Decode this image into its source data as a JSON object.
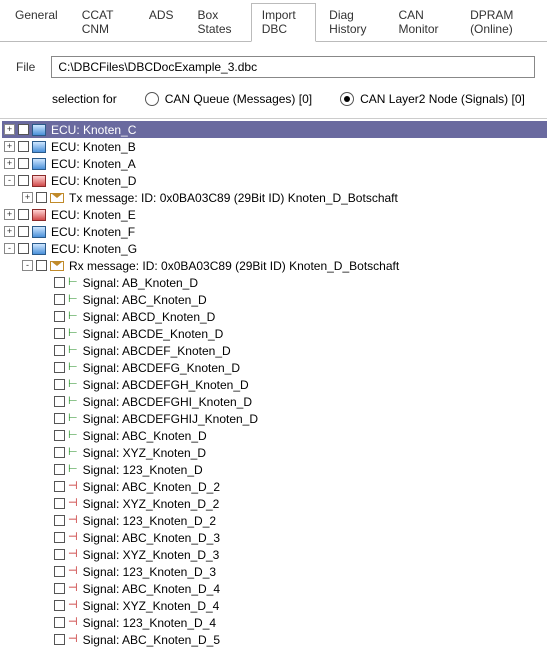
{
  "tabs": {
    "items": [
      "General",
      "CCAT CNM",
      "ADS",
      "Box States",
      "Import DBC",
      "Diag History",
      "CAN Monitor",
      "DPRAM (Online)"
    ],
    "activeIndex": 4
  },
  "fileRow": {
    "label": "File",
    "path": "C:\\DBCFiles\\DBCDocExample_3.dbc"
  },
  "selection": {
    "label": "selection for",
    "opt1": "CAN Queue (Messages) [0]",
    "opt2": "CAN Layer2 Node (Signals) [0]",
    "checked": 1
  },
  "tree": [
    {
      "indent": 0,
      "exp": "+",
      "chk": true,
      "icon": "ecu",
      "text": "ECU:   Knoten_C",
      "sel": true
    },
    {
      "indent": 0,
      "exp": "+",
      "chk": true,
      "icon": "ecu",
      "text": "ECU:   Knoten_B"
    },
    {
      "indent": 0,
      "exp": "+",
      "chk": true,
      "icon": "ecu",
      "text": "ECU:   Knoten_A"
    },
    {
      "indent": 0,
      "exp": "-",
      "chk": true,
      "icon": "ecu-r",
      "text": "ECU:   Knoten_D"
    },
    {
      "indent": 1,
      "exp": "+",
      "chk": true,
      "icon": "msg",
      "text": "Tx message:   ID: 0x0BA03C89   (29Bit ID)   Knoten_D_Botschaft"
    },
    {
      "indent": 0,
      "exp": "+",
      "chk": true,
      "icon": "ecu-r",
      "text": "ECU:   Knoten_E"
    },
    {
      "indent": 0,
      "exp": "+",
      "chk": true,
      "icon": "ecu",
      "text": "ECU:   Knoten_F"
    },
    {
      "indent": 0,
      "exp": "-",
      "chk": true,
      "icon": "ecu",
      "text": "ECU:   Knoten_G"
    },
    {
      "indent": 1,
      "exp": "-",
      "chk": false,
      "icon": "msg",
      "text": "Rx message:   ID: 0x0BA03C89   (29Bit ID)   Knoten_D_Botschaft"
    },
    {
      "indent": 2,
      "exp": "",
      "chk": false,
      "icon": "sig-in",
      "text": "Signal: AB_Knoten_D"
    },
    {
      "indent": 2,
      "exp": "",
      "chk": false,
      "icon": "sig-in",
      "text": "Signal: ABC_Knoten_D"
    },
    {
      "indent": 2,
      "exp": "",
      "chk": false,
      "icon": "sig-in",
      "text": "Signal: ABCD_Knoten_D"
    },
    {
      "indent": 2,
      "exp": "",
      "chk": false,
      "icon": "sig-in",
      "text": "Signal: ABCDE_Knoten_D"
    },
    {
      "indent": 2,
      "exp": "",
      "chk": false,
      "icon": "sig-in",
      "text": "Signal: ABCDEF_Knoten_D"
    },
    {
      "indent": 2,
      "exp": "",
      "chk": false,
      "icon": "sig-in",
      "text": "Signal: ABCDEFG_Knoten_D"
    },
    {
      "indent": 2,
      "exp": "",
      "chk": false,
      "icon": "sig-in",
      "text": "Signal: ABCDEFGH_Knoten_D"
    },
    {
      "indent": 2,
      "exp": "",
      "chk": false,
      "icon": "sig-in",
      "text": "Signal: ABCDEFGHI_Knoten_D"
    },
    {
      "indent": 2,
      "exp": "",
      "chk": false,
      "icon": "sig-in",
      "text": "Signal: ABCDEFGHIJ_Knoten_D"
    },
    {
      "indent": 2,
      "exp": "",
      "chk": false,
      "icon": "sig-in",
      "text": "Signal: ABC_Knoten_D"
    },
    {
      "indent": 2,
      "exp": "",
      "chk": false,
      "icon": "sig-in",
      "text": "Signal: XYZ_Knoten_D"
    },
    {
      "indent": 2,
      "exp": "",
      "chk": false,
      "icon": "sig-in",
      "text": "Signal: 123_Knoten_D"
    },
    {
      "indent": 2,
      "exp": "",
      "chk": false,
      "icon": "sig-out",
      "text": "Signal: ABC_Knoten_D_2"
    },
    {
      "indent": 2,
      "exp": "",
      "chk": false,
      "icon": "sig-out",
      "text": "Signal: XYZ_Knoten_D_2"
    },
    {
      "indent": 2,
      "exp": "",
      "chk": false,
      "icon": "sig-out",
      "text": "Signal: 123_Knoten_D_2"
    },
    {
      "indent": 2,
      "exp": "",
      "chk": false,
      "icon": "sig-out",
      "text": "Signal: ABC_Knoten_D_3"
    },
    {
      "indent": 2,
      "exp": "",
      "chk": false,
      "icon": "sig-out",
      "text": "Signal: XYZ_Knoten_D_3"
    },
    {
      "indent": 2,
      "exp": "",
      "chk": false,
      "icon": "sig-out",
      "text": "Signal: 123_Knoten_D_3"
    },
    {
      "indent": 2,
      "exp": "",
      "chk": false,
      "icon": "sig-out",
      "text": "Signal: ABC_Knoten_D_4"
    },
    {
      "indent": 2,
      "exp": "",
      "chk": false,
      "icon": "sig-out",
      "text": "Signal: XYZ_Knoten_D_4"
    },
    {
      "indent": 2,
      "exp": "",
      "chk": false,
      "icon": "sig-out",
      "text": "Signal: 123_Knoten_D_4"
    },
    {
      "indent": 2,
      "exp": "",
      "chk": false,
      "icon": "sig-out",
      "text": "Signal: ABC_Knoten_D_5"
    }
  ]
}
